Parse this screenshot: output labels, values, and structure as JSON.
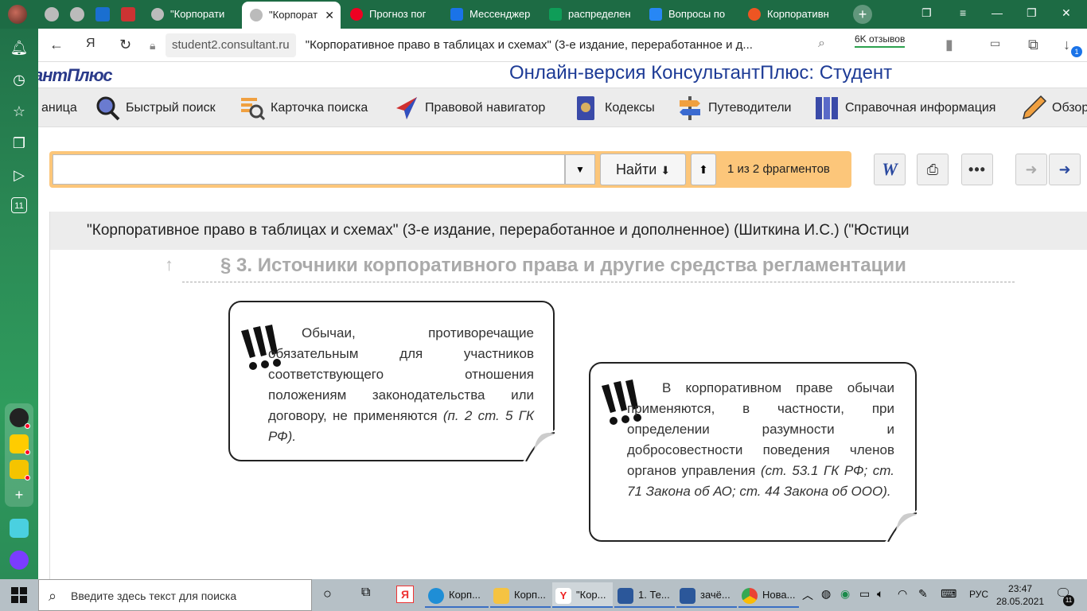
{
  "browser": {
    "tabs": [
      {
        "label": "\"Корпорати",
        "active": false
      },
      {
        "label": "\"Корпорат",
        "active": true
      },
      {
        "label": "Прогноз пог",
        "active": false
      },
      {
        "label": "Мессенджер",
        "active": false
      },
      {
        "label": "распределен",
        "active": false
      },
      {
        "label": "Вопросы по",
        "active": false
      },
      {
        "label": "Корпоративн",
        "active": false
      }
    ],
    "close_glyph": "✕",
    "address": {
      "domain": "student2.consultant.ru",
      "page_title": "\"Корпоративное право в таблицах и схемах\" (3-е издание, переработанное и д...",
      "reviews": "6K отзывов",
      "badge": "1"
    },
    "sidebar_badge": "11"
  },
  "site": {
    "brand": "антПлюс",
    "product_title": "Онлайн-версия КонсультантПлюс: Студент",
    "menu": [
      {
        "label": "аница"
      },
      {
        "label": "Быстрый поиск"
      },
      {
        "label": "Карточка поиска"
      },
      {
        "label": "Правовой навигатор"
      },
      {
        "label": "Кодексы"
      },
      {
        "label": "Путеводители"
      },
      {
        "label": "Справочная информация"
      },
      {
        "label": "Обзор"
      }
    ],
    "search": {
      "value": "",
      "find_label": "Найти",
      "fragments": "1 из 2 фрагментов"
    }
  },
  "document": {
    "title": "\"Корпоративное право в таблицах и схемах\" (3-е издание, переработанное и дополненное) (Шиткина И.С.) (\"Юстици",
    "section": "§ 3. Источники корпоративного права и другие средства регламентации",
    "notes": [
      {
        "text": "Обычаи, противоречащие обязательным для участников соответствующего отношения положениям законодательства или договору, не применяются",
        "ref": "(п. 2 ст. 5 ГК РФ)."
      },
      {
        "text": "В корпоративном праве обычаи применяются, в частности, при определении разумности и добросовестности поведения членов органов управления",
        "ref": "(ст. 53.1 ГК РФ; ст. 71 Закона об АО; ст. 44 Закона об ООО)."
      }
    ]
  },
  "taskbar": {
    "search_placeholder": "Введите здесь текст для поиска",
    "apps": [
      {
        "label": "Корп..."
      },
      {
        "label": "Корп..."
      },
      {
        "label": "\"Кор..."
      },
      {
        "label": "1. Те..."
      },
      {
        "label": "зачё..."
      },
      {
        "label": "Нова..."
      }
    ],
    "lang": "РУС",
    "time": "23:47",
    "date": "28.05.2021",
    "notif": "11"
  },
  "colors": {
    "accent_green": "#1d6b44",
    "search_bar": "#fcc67a",
    "product_blue": "#1d3b96"
  }
}
